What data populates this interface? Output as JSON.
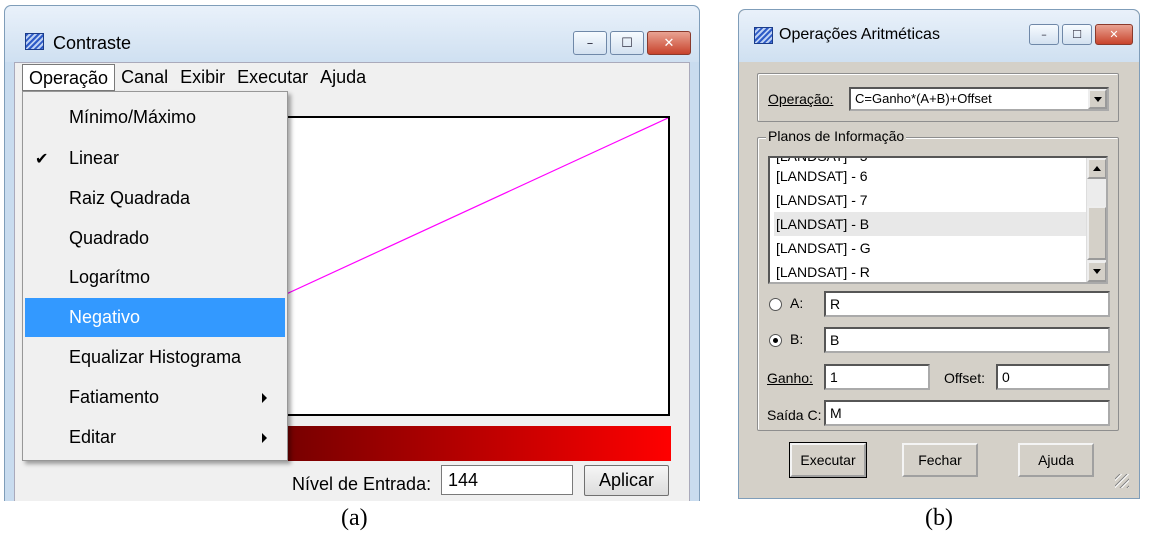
{
  "window_a": {
    "title": "Contraste",
    "controls": {
      "minimize": "–",
      "maximize": "☐",
      "close": "✕"
    },
    "menubar": [
      "Operação",
      "Canal",
      "Exibir",
      "Executar",
      "Ajuda"
    ],
    "menu": {
      "items": [
        {
          "label": "Mínimo/Máximo"
        },
        {
          "label": "Linear",
          "checked": "✔"
        },
        {
          "label": "Raiz Quadrada"
        },
        {
          "label": "Quadrado"
        },
        {
          "label": "Logarítmo"
        },
        {
          "label": "Negativo",
          "highlighted": true
        },
        {
          "label": "Equalizar Histograma"
        },
        {
          "label": "Fatiamento",
          "submenu": true
        },
        {
          "label": "Editar",
          "submenu": true
        }
      ]
    },
    "curve": {
      "color": "#ff00ff",
      "type": "line",
      "x": [
        0,
        255
      ],
      "y": [
        0,
        255
      ]
    },
    "color_bar": {
      "from": "#1a0000",
      "to": "#ff0000"
    },
    "nivel_label": "Nível de Entrada:",
    "nivel_value": "144",
    "apply_button": "Aplicar"
  },
  "window_b": {
    "title": "Operações Aritméticas",
    "operacao_label": "Operação:",
    "operacao_value": "C=Ganho*(A+B)+Offset",
    "planos_legend": "Planos de Informação",
    "list_items": [
      "[LANDSAT] - 6",
      "[LANDSAT] - 7",
      "[LANDSAT] - B",
      "[LANDSAT] - G",
      "[LANDSAT] - R"
    ],
    "selected_item": "[LANDSAT] - B",
    "a_label": "A:",
    "a_value": "R",
    "b_label": "B:",
    "b_value": "B",
    "b_selected": true,
    "ganho_label": "Ganho:",
    "ganho_value": "1",
    "offset_label": "Offset:",
    "offset_value": "0",
    "saida_label": "Saída C:",
    "saida_value": "M",
    "buttons": {
      "executar": "Executar",
      "fechar": "Fechar",
      "ajuda": "Ajuda"
    }
  },
  "captions": {
    "a": "(a)",
    "b": "(b)"
  }
}
